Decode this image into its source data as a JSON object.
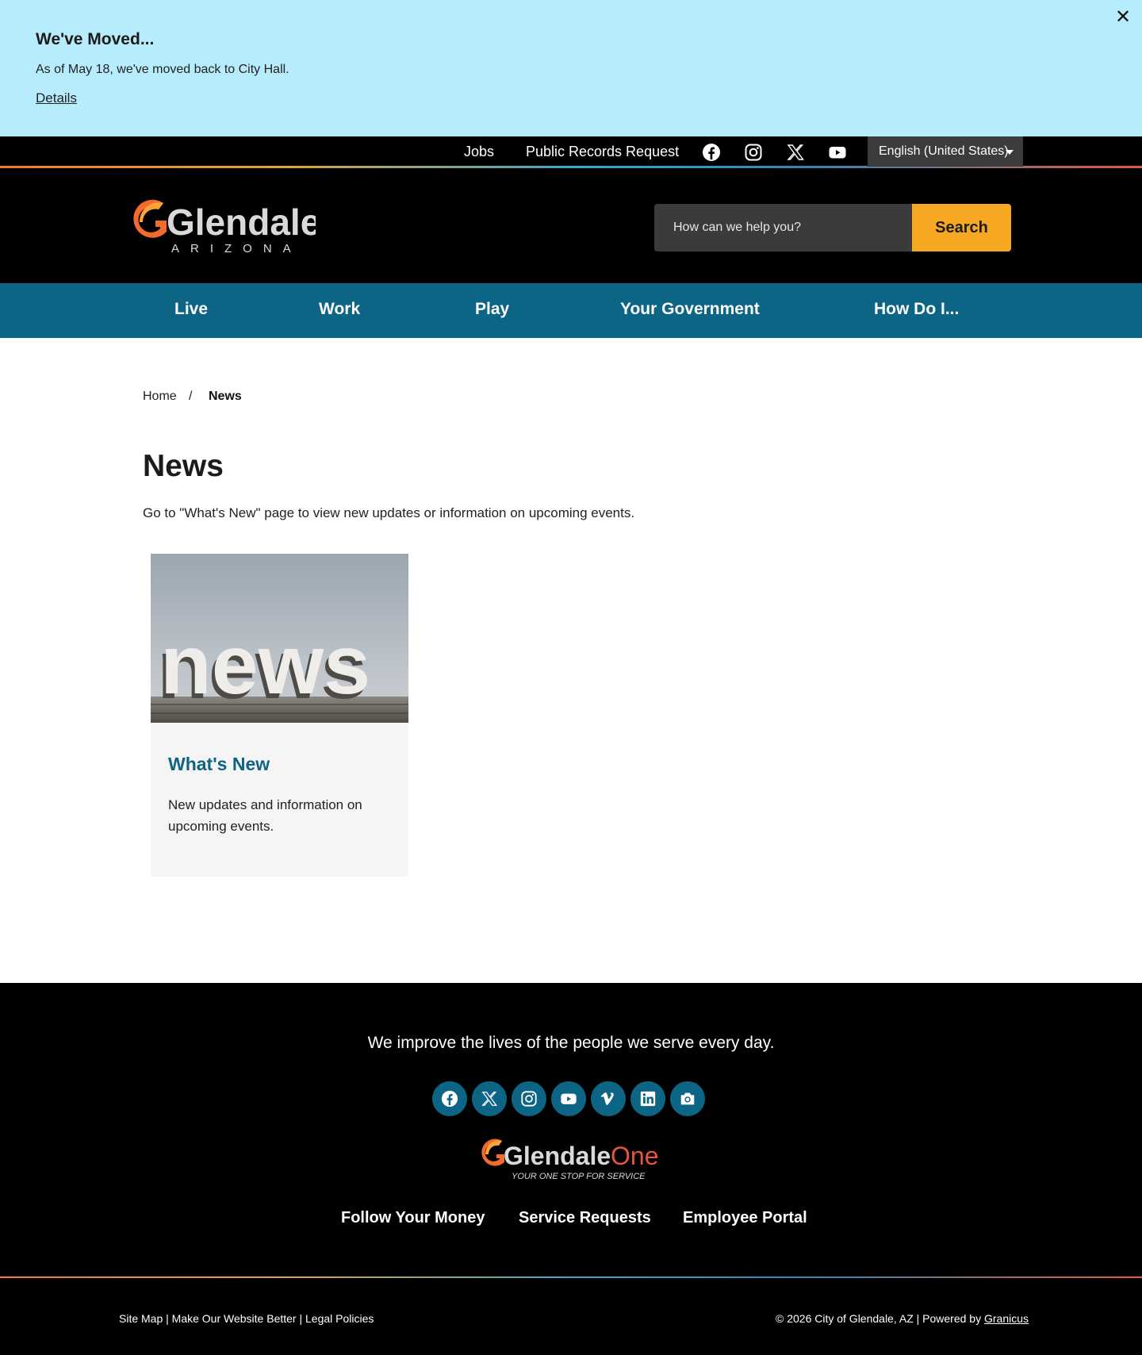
{
  "alert": {
    "title": "We've Moved...",
    "text": "As of May 18, we've moved back to City Hall.",
    "link": "Details",
    "close": "✕"
  },
  "utility": {
    "links": [
      "Jobs",
      "Public Records Request"
    ],
    "social_icons": [
      "facebook-icon",
      "instagram-icon",
      "x-icon",
      "youtube-icon"
    ],
    "language": "English (United States)"
  },
  "header": {
    "logo_main": "Glendale",
    "logo_sub": "ARIZONA",
    "search_placeholder": "How can we help you?",
    "search_button": "Search"
  },
  "nav": {
    "items": [
      "Live",
      "Work",
      "Play",
      "Your Government",
      "How Do I..."
    ]
  },
  "breadcrumb": {
    "home": "Home",
    "separator": "/",
    "current": "News"
  },
  "main": {
    "title": "News",
    "intro": "Go to \"What's New\" page to view new updates or information on upcoming events."
  },
  "card": {
    "image_word": "news",
    "title": "What's New",
    "description": "New updates and information on upcoming events."
  },
  "footer": {
    "tagline": "We improve the lives of the people we serve every day.",
    "social_icons": [
      "facebook-icon",
      "x-icon",
      "instagram-icon",
      "youtube-icon",
      "vimeo-icon",
      "linkedin-icon",
      "camera-icon"
    ],
    "g1_logo_main": "Glendale",
    "g1_logo_one": "One",
    "g1_tagline": "YOUR ONE STOP FOR SERVICE",
    "links": [
      "Follow Your Money",
      "Service Requests",
      "Employee Portal"
    ],
    "bottom_left": [
      "Site Map",
      "Make Our Website Better",
      "Legal Policies"
    ],
    "bottom_sep": "|",
    "copyright": "© 2026 City of Glendale, AZ | Powered by",
    "powered_by": "Granicus"
  },
  "colors": {
    "alert_bg": "#b6ecfc",
    "nav_bg": "#0d6585",
    "accent": "#f7a823",
    "card_title": "#0e6482"
  }
}
